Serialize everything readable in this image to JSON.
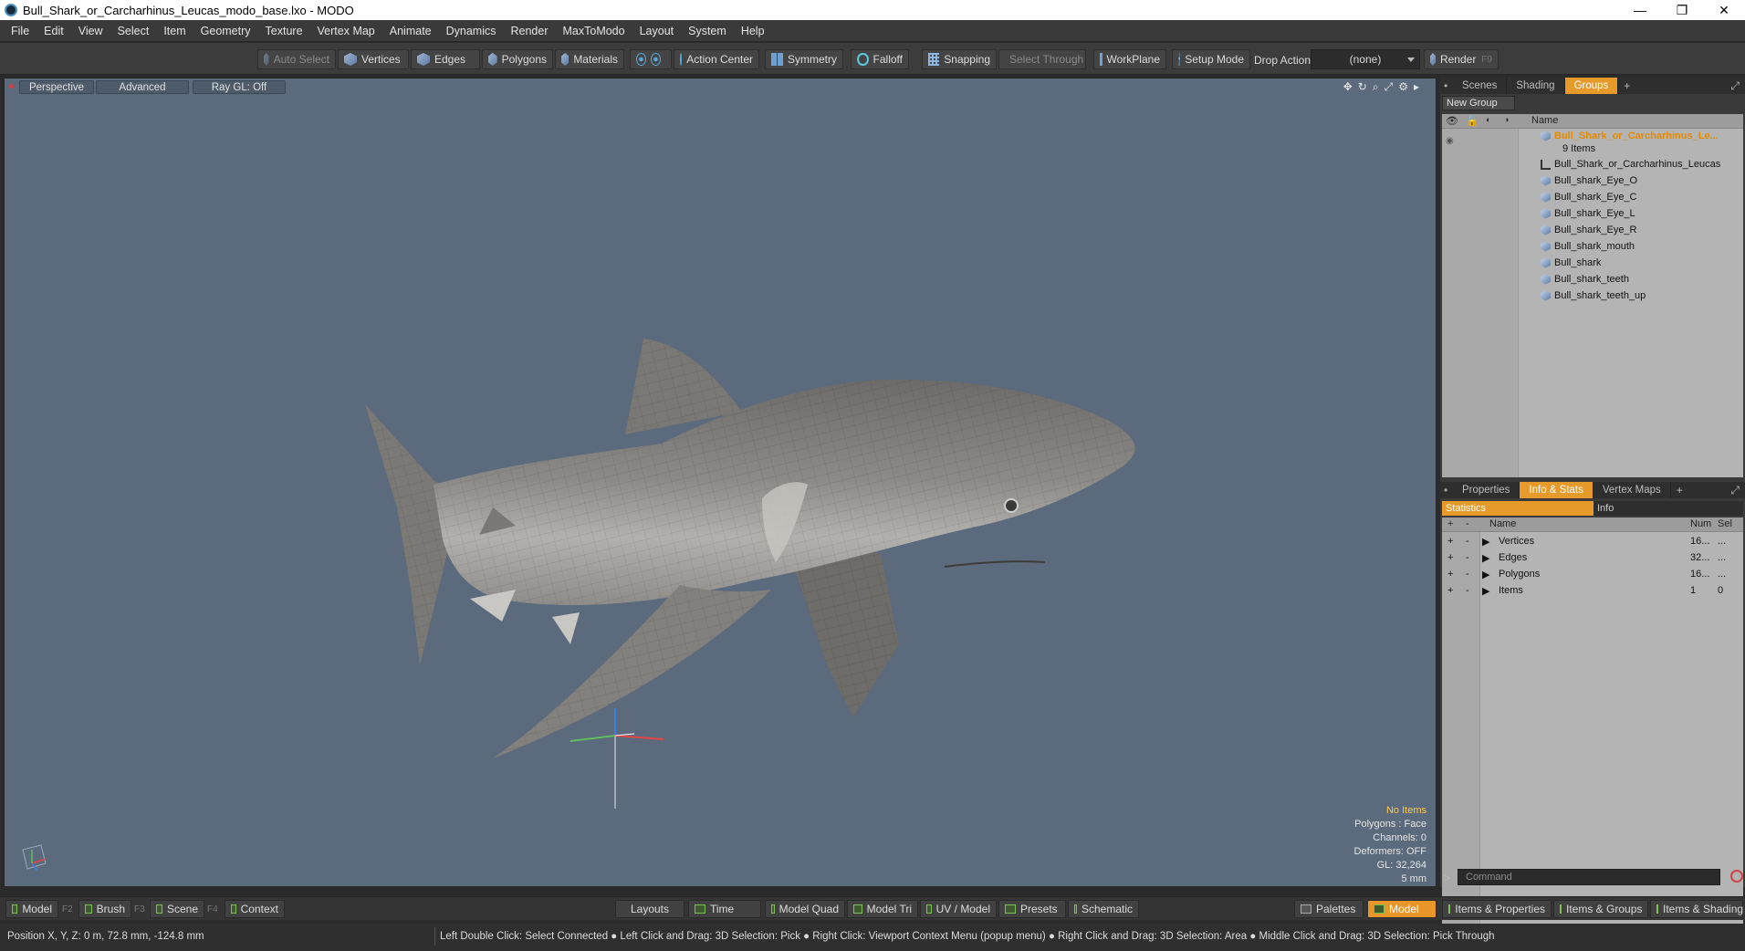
{
  "window": {
    "title": "Bull_Shark_or_Carcharhinus_Leucas_modo_base.lxo - MODO",
    "minimize": "—",
    "restore": "❐",
    "close": "✕"
  },
  "menu": [
    "File",
    "Edit",
    "View",
    "Select",
    "Item",
    "Geometry",
    "Texture",
    "Vertex Map",
    "Animate",
    "Dynamics",
    "Render",
    "MaxToModo",
    "Layout",
    "System",
    "Help"
  ],
  "toolbar": {
    "auto_select": "Auto Select",
    "vertices": "Vertices",
    "edges": "Edges",
    "polygons": "Polygons",
    "materials": "Materials",
    "action_center": "Action Center",
    "symmetry": "Symmetry",
    "falloff": "Falloff",
    "snapping": "Snapping",
    "select_through": "Select Through",
    "workplane": "WorkPlane",
    "setup_mode": "Setup Mode",
    "drop_action_label": "Drop Action",
    "drop_action_value": "(none)",
    "render": "Render",
    "render_key": "F9"
  },
  "viewport": {
    "view_mode": "Perspective",
    "shading": "Advanced",
    "raygl": "Ray GL: Off",
    "overlay": {
      "no_items": "No Items",
      "polygons": "Polygons : Face",
      "channels": "Channels: 0",
      "deformers": "Deformers: OFF",
      "gl": "GL: 32,264",
      "grid": "5 mm"
    }
  },
  "groups_panel": {
    "tabs": [
      "Scenes",
      "Shading",
      "Groups"
    ],
    "active_tab": "Groups",
    "new_group": "New Group",
    "col_name": "Name",
    "group_name": "Bull_Shark_or_Carcharhinus_Le...",
    "group_count": "9 Items",
    "items": [
      "Bull_Shark_or_Carcharhinus_Leucas",
      "Bull_shark_Eye_O",
      "Bull_shark_Eye_C",
      "Bull_shark_Eye_L",
      "Bull_shark_Eye_R",
      "Bull_shark_mouth",
      "Bull_shark",
      "Bull_shark_teeth",
      "Bull_shark_teeth_up"
    ]
  },
  "info_panel": {
    "tabs": [
      "Properties",
      "Info & Stats",
      "Vertex Maps"
    ],
    "active_tab": "Info & Stats",
    "sub_tabs": [
      "Statistics",
      "Info"
    ],
    "cols": {
      "name": "Name",
      "num": "Num",
      "sel": "Sel"
    },
    "rows": [
      {
        "name": "Vertices",
        "num": "16...",
        "sel": "..."
      },
      {
        "name": "Edges",
        "num": "32...",
        "sel": "..."
      },
      {
        "name": "Polygons",
        "num": "16...",
        "sel": "..."
      },
      {
        "name": "Items",
        "num": "1",
        "sel": "0"
      }
    ],
    "plus": "+",
    "minus": "-"
  },
  "command": {
    "placeholder": "Command"
  },
  "bottom": {
    "model": "Model",
    "model_key": "F2",
    "brush": "Brush",
    "brush_key": "F3",
    "scene": "Scene",
    "scene_key": "F4",
    "context": "Context",
    "layouts": "Layouts",
    "time": "Time",
    "model_quad": "Model Quad",
    "model_tri": "Model Tri",
    "uv_model": "UV / Model",
    "presets": "Presets",
    "schematic": "Schematic",
    "palettes": "Palettes",
    "model_active": "Model",
    "items_properties": "Items & Properties",
    "items_groups": "Items & Groups",
    "items_shading": "Items & Shading"
  },
  "status": {
    "position": "Position X, Y, Z:   0 m, 72.8 mm, -124.8 mm",
    "hint": "Left Double Click: Select Connected ● Left Click and Drag: 3D Selection: Pick ● Right Click: Viewport Context Menu (popup menu) ● Right Click and Drag: 3D Selection: Area ● Middle Click and Drag: 3D Selection: Pick Through"
  }
}
